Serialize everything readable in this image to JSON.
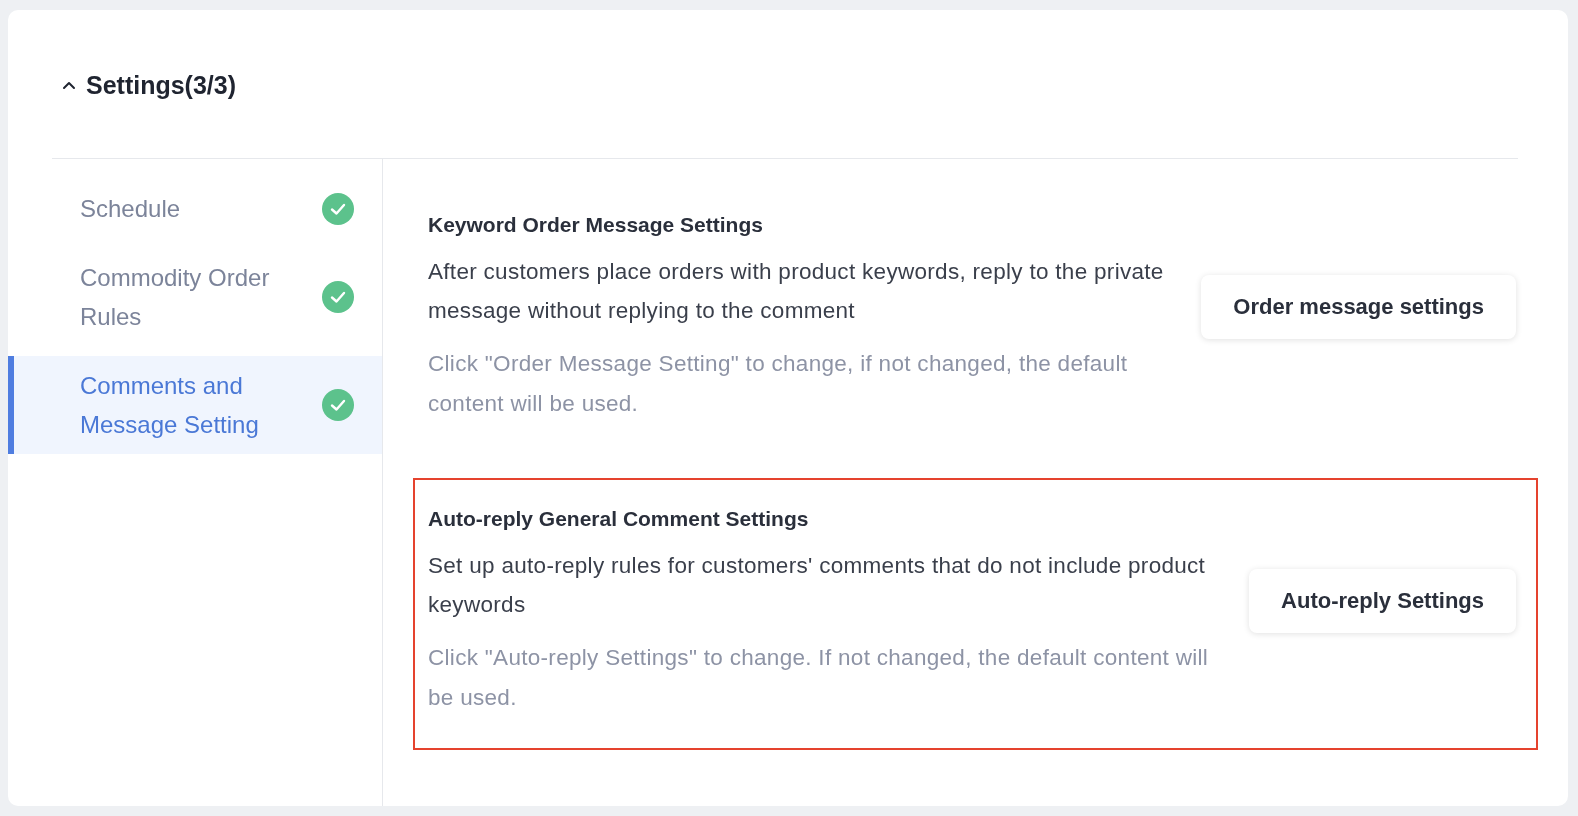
{
  "header": {
    "title": "Settings(3/3)",
    "expanded": true
  },
  "steps": [
    {
      "label": "Schedule",
      "done": true,
      "selected": false
    },
    {
      "label": "Commodity Order Rules",
      "done": true,
      "selected": false
    },
    {
      "label": "Comments and Message Setting",
      "done": true,
      "selected": true
    }
  ],
  "sections": [
    {
      "title": "Keyword Order Message Settings",
      "description": "After customers place orders with product keywords, reply to the private message without replying to the comment",
      "hint": "Click \"Order Message Setting\" to change, if not changed, the default content will be used.",
      "button": "Order message settings",
      "highlighted": false
    },
    {
      "title": "Auto-reply General Comment Settings",
      "description": "Set up auto-reply rules for customers' comments that do not include product keywords",
      "hint": "Click \"Auto-reply Settings\" to change. If not changed, the default content will be used.",
      "button": "Auto-reply Settings",
      "highlighted": true
    }
  ]
}
